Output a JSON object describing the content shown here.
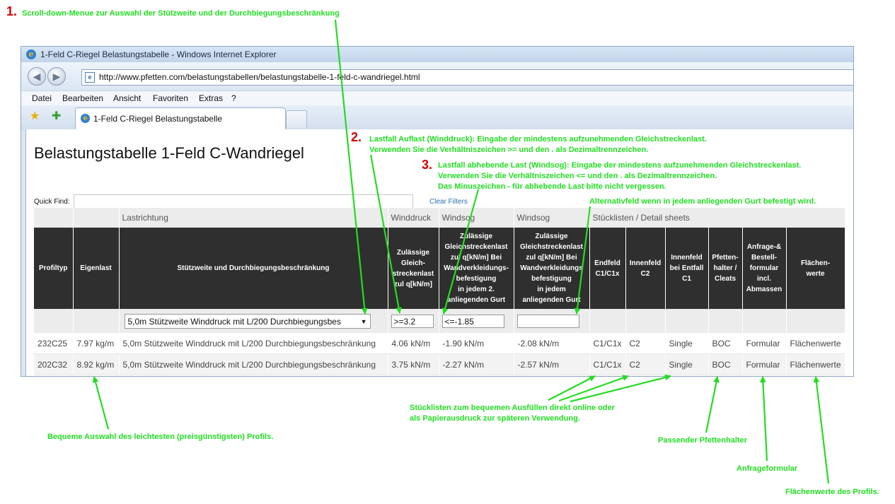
{
  "annotations": {
    "n1": "1.",
    "a1": "Scroll-down-Menue zur Auswahl der Stützweite und der Durchbiegungsbeschränkung",
    "n2": "2.",
    "a2_l1": "Lastfall Auflast (Winddruck): Eingabe der mindestens aufzunehmenden Gleichstreckenlast.",
    "a2_l2": "Verwenden Sie die Verhältniszeichen >= und den . als Dezimaltrennzeichen.",
    "n3": "3.",
    "a3_l1": "Lastfall abhebende Last (Windsog): Eingabe der mindestens aufzunehmenden Gleichstreckenlast.",
    "a3_l2": "Verwenden Sie die Verhältniszeichen <= und den . als Dezimaltrennzeichen.",
    "a3_l3": "Das Minuszeichen - für abhebende Last bitte nicht vergessen.",
    "alt": "Alternativfeld wenn in jedem anliegenden Gurt befestigt wird.",
    "bequem": "Bequeme Auswahl des leichtesten (preisgünstigsten) Profils.",
    "stk_l1": "Stücklisten zum bequemen Ausfüllen direkt online oder",
    "stk_l2": "als Papierausdruck zur späteren Verwendung.",
    "pfetten": "Passender Pfettenhalter",
    "anfrage": "Anfrageformular",
    "flaechen": "Flächenwerte des Profils.",
    "color": "#22dd22",
    "number_color": "#d40000"
  },
  "browser": {
    "window_title": "1-Feld C-Riegel Belastungstabelle - Windows Internet Explorer",
    "url": "http://www.pfetten.com/belastungstabellen/belastungstabelle-1-feld-c-wandriegel.html",
    "menu": [
      "Datei",
      "Bearbeiten",
      "Ansicht",
      "Favoriten",
      "Extras",
      "?"
    ],
    "tab_title": "1-Feld C-Riegel Belastungstabelle",
    "icons": [
      "back-icon",
      "forward-icon",
      "ie-logo-icon",
      "favorites-star-icon",
      "add-favorite-icon"
    ]
  },
  "page": {
    "title": "Belastungstabelle 1-Feld C-Wandriegel",
    "quick_find_label": "Quick Find:",
    "quick_find_value": "",
    "clear_filters": "Clear Filters"
  },
  "table": {
    "group_headers": {
      "lastrichtung": "Lastrichtung",
      "winddruck": "Winddruck",
      "windsog1": "Windsog",
      "windsog2": "Windsog",
      "stuecklisten": "Stücklisten / Detail sheets"
    },
    "headers": {
      "profiltyp": "Profiltyp",
      "eigenlast": "Eigenlast",
      "stuetzweite": "Stützweite und Durchbiegungsbeschränkung",
      "druck_l1": "Zulässige",
      "druck_l2": "Gleich-",
      "druck_l3": "streckenlast",
      "druck_l4": "zul q[kN/m]",
      "sog_l1": "Zulässige",
      "sog_l2": "Gleichstreckenlast",
      "sog_l3": "zul q[kN/m] Bei",
      "sog_l4": "Wandverkleidungs-",
      "sog_l5": "befestigung",
      "sog_l6": "in jedem 2.",
      "sog_l7": "anliegenden Gurt",
      "sog2_l1": "Zulässige",
      "sog2_l2": "Gleichstreckenlast",
      "sog2_l3": "zul q[kN/m] Bei",
      "sog2_l4": "Wandverkleidungs",
      "sog2_l5": "befestigung",
      "sog2_l6": "in jedem",
      "sog2_l7": "anliegenden Gurt",
      "endfeld_l1": "Endfeld",
      "endfeld_l2": "C1/C1x",
      "innenfeld_l1": "Innenfeld",
      "innenfeld_l2": "C2",
      "entfall_l1": "Innenfeld",
      "entfall_l2": "bei Entfall",
      "entfall_l3": "C1",
      "pfetten_l1": "Pfetten-",
      "pfetten_l2": "halter /",
      "pfetten_l3": "Cleats",
      "anfrage_l1": "Anfrage-&",
      "anfrage_l2": "Bestell-",
      "anfrage_l3": "formular",
      "anfrage_l4": "incl.",
      "anfrage_l5": "Abmassen",
      "flaechen_l1": "Flächen-",
      "flaechen_l2": "werte"
    },
    "filters": {
      "stuetzweite_select": "5,0m Stützweite Winddruck mit L/200 Durchbiegungsbes",
      "winddruck": ">=3.2",
      "windsog": "<=-1.85",
      "windsog2": ""
    },
    "rows": [
      {
        "profiltyp": "232C25",
        "eigenlast": "7.97 kg/m",
        "stuetzweite": "5,0m Stützweite Winddruck mit L/200 Durchbiegungsbeschränkung",
        "winddruck": "4.06 kN/m",
        "windsog": "-1.90 kN/m",
        "windsog2": "-2.08 kN/m",
        "endfeld": "C1/C1x",
        "innenfeld": "C2",
        "entfall": "Single",
        "pfettenhalter": "BOC",
        "anfrage": "Formular",
        "flaechen": "Flächenwerte"
      },
      {
        "profiltyp": "202C32",
        "eigenlast": "8.92 kg/m",
        "stuetzweite": "5,0m Stützweite Winddruck mit L/200 Durchbiegungsbeschränkung",
        "winddruck": "3.75 kN/m",
        "windsog": "-2.27 kN/m",
        "windsog2": "-2.57 kN/m",
        "endfeld": "C1/C1x",
        "innenfeld": "C2",
        "entfall": "Single",
        "pfettenhalter": "BOC",
        "anfrage": "Formular",
        "flaechen": "Flächenwerte"
      }
    ]
  }
}
